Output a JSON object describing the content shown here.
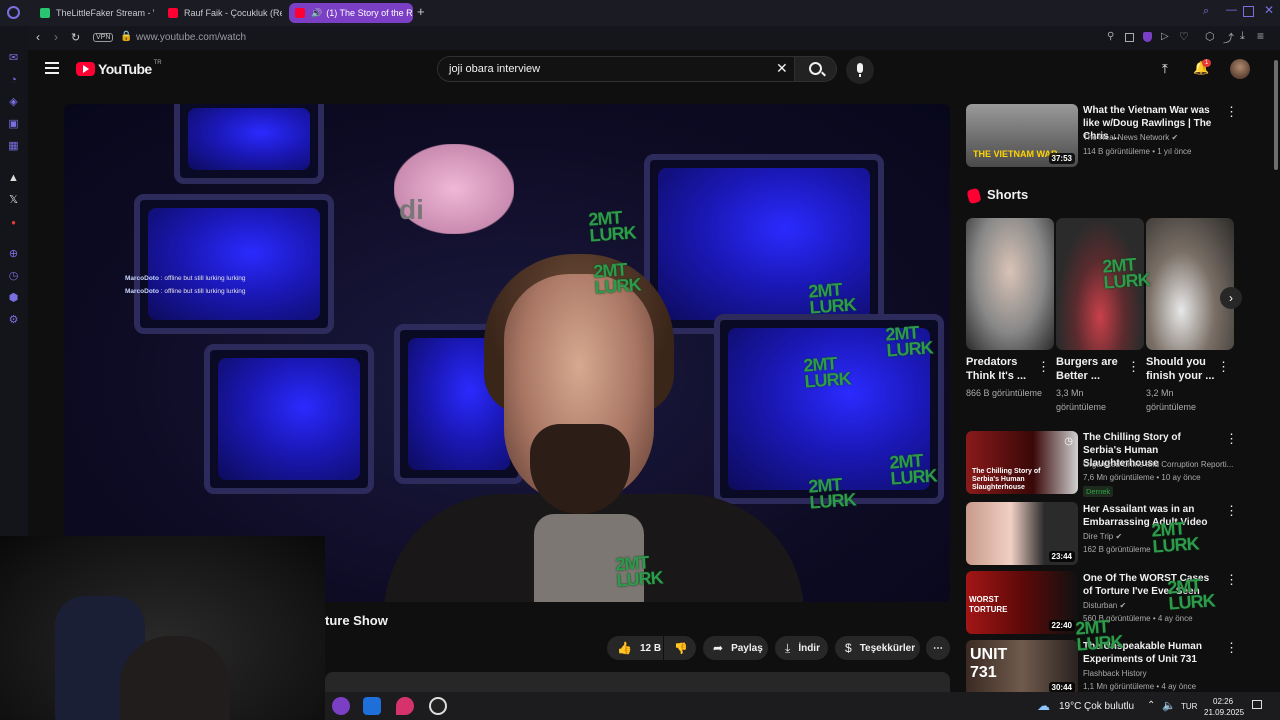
{
  "browser": {
    "tabs": [
      {
        "title": "TheLittleFaker Stream - W",
        "favicon_color": "#28c76f"
      },
      {
        "title": "Rauf Faik - Çocukluk (Re",
        "favicon_color": "#ff0033"
      },
      {
        "title": "(1) The Story of the Re",
        "favicon_color": "#ff0033",
        "active": true
      }
    ],
    "vpn_label": "VPN",
    "url": "www.youtube.com/watch",
    "accent": "#7b3fc6"
  },
  "youtube": {
    "logo_text": "YouTube",
    "region": "TR",
    "search_value": "joji obara interview",
    "notif_count": "1",
    "video_title_partial": "ture Show",
    "actions": {
      "like_count": "12 B",
      "share": "Paylaş",
      "download": "İndir",
      "thanks": "Teşekkürler"
    },
    "overlay": {
      "chat_user": "MarcoDoto",
      "chat_msg": " : offline but still lurking lurking",
      "lurk_line1": "2MT",
      "lurk_line2": "LURK",
      "sign_text": "di"
    },
    "shorts_label": "Shorts",
    "sidebar_videos": [
      {
        "title": "What the Vietnam War was like w/Doug Rawlings | The Chris ...",
        "channel": "The Real News Network",
        "meta": "114 B görüntüleme • 1 yıl önce",
        "duration": "37:53",
        "thumb_text": "THE VIETNAM WAR",
        "verified": true
      },
      {
        "title": "The Chilling Story of Serbia's Human Slaughterhouse",
        "channel": "Organized Crime and Corruption Reporti...",
        "meta": "7,6 Mn görüntüleme • 10 ay önce",
        "badge": "Dernek",
        "thumb_text": "The Chilling Story of Serbia's Human Slaughterhouse"
      },
      {
        "title": "Her Assailant was in an Embarrassing Adult Video",
        "channel": "Dire Trip",
        "meta": "162 B görüntüleme",
        "duration": "23:44",
        "verified": true
      },
      {
        "title": "One Of The WORST Cases of Torture I've Ever Seen",
        "channel": "Disturban",
        "meta": "560 B görüntüleme • 4 ay önce",
        "duration": "22:40",
        "thumb_text": "WORST TORTURE",
        "verified": true
      },
      {
        "title": "The Unspeakable Human Experiments of Unit 731",
        "channel": "Flashback History",
        "meta": "1,1 Mn görüntüleme • 4 ay önce",
        "duration": "30:44",
        "thumb_text": "UNIT 731"
      }
    ],
    "shorts": [
      {
        "title": "Predators Think It's ...",
        "views": "866 B görüntüleme"
      },
      {
        "title": "Burgers are Better ...",
        "views": "3,3 Mn görüntüleme"
      },
      {
        "title": "Should you finish your ...",
        "views": "3,2 Mn görüntüleme"
      }
    ]
  },
  "taskbar": {
    "weather": "19°C",
    "weather_desc": "Çok bulutlu",
    "lang": "TUR",
    "time": "02:26",
    "date": "21.09.2025"
  }
}
